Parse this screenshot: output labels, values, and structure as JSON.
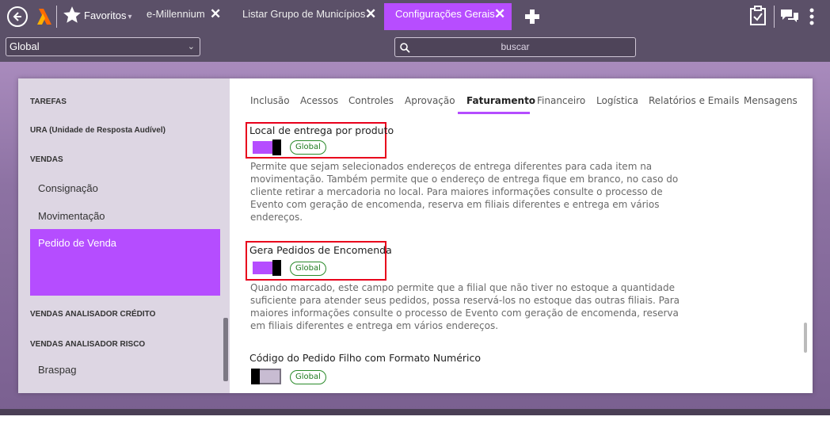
{
  "topbar": {
    "favorites_label": "Favoritos",
    "favorites_caret": "▾",
    "tabs": [
      {
        "label": "e-Millennium",
        "close": "✕"
      },
      {
        "label": "Listar Grupo de Municípios",
        "close": "✕"
      },
      {
        "label": "Configurações Gerais",
        "close": "✕"
      }
    ]
  },
  "subbar": {
    "scope_value": "Global",
    "scope_chevron": "⌄",
    "search_placeholder": "buscar"
  },
  "sidebar": {
    "items": [
      {
        "label": "TAREFAS"
      },
      {
        "label": "URA (Unidade de Resposta Audível)"
      },
      {
        "label": "VENDAS"
      },
      {
        "label": "Consignação"
      },
      {
        "label": "Movimentação"
      },
      {
        "label": "Pedido de Venda"
      },
      {
        "label": "VENDAS ANALISADOR CRÉDITO"
      },
      {
        "label": "VENDAS ANALISADOR RISCO"
      },
      {
        "label": "Braspag"
      }
    ]
  },
  "content": {
    "tabs": [
      "Inclusão",
      "Acessos",
      "Controles",
      "Aprovação",
      "Faturamento",
      "Financeiro",
      "Logística",
      "Relatórios e Emails",
      "Mensagens"
    ],
    "active_tab": "Faturamento",
    "settings": [
      {
        "title": "Local de entrega por produto",
        "state": "on",
        "badge": "Global",
        "description": [
          "Permite que sejam selecionados endereços de entrega diferentes para cada item na",
          "movimentação. Também permite que o endereço de entrega fique em branco, no caso do",
          "cliente retirar a mercadoria no local. Para maiores informações consulte o processo de",
          "Evento com geração de encomenda, reserva em filiais diferentes e entrega em vários",
          "endereços."
        ]
      },
      {
        "title": "Gera Pedidos de Encomenda",
        "state": "on",
        "badge": "Global",
        "description": [
          "Quando marcado, este campo permite que a filial que não tiver no estoque a quantidade",
          "suficiente para atender seus pedidos, possa reservá-los no estoque das outras filiais. Para",
          "maiores informações consulte o processo de Evento com geração de encomenda, reserva",
          "em filiais diferentes e entrega em vários endereços."
        ]
      },
      {
        "title": "Código do Pedido Filho com Formato Numérico",
        "state": "off",
        "badge": "Global",
        "description": []
      }
    ]
  },
  "colors": {
    "accent": "#b54dff",
    "highlight_border": "#e8001c",
    "badge_green": "#1f7a1f",
    "topbar": "#5b5068"
  }
}
